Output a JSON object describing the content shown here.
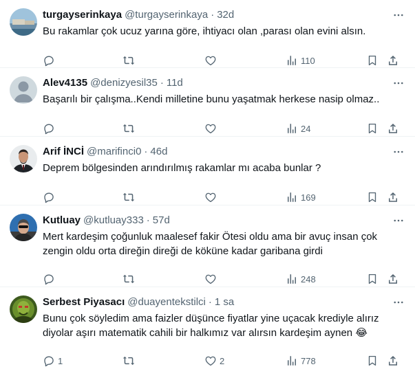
{
  "replies": [
    {
      "name": "turgayserinkaya",
      "handle": "@turgayserinkaya",
      "time": "32d",
      "text": "Bu rakamlar çok ucuz yarına göre, ihtiyacı olan ,parası olan evini alsın.",
      "reply_count": "",
      "repost_count": "",
      "like_count": "",
      "views": "110",
      "avatar": "landscape-photo"
    },
    {
      "name": "Alev4135",
      "handle": "@denizyesil35",
      "time": "11d",
      "text": "Başarılı bir çalışma..Kendi milletine bunu yaşatmak herkese nasip olmaz..",
      "reply_count": "",
      "repost_count": "",
      "like_count": "",
      "views": "24",
      "avatar": "default-person"
    },
    {
      "name": "Arif İNCİ",
      "handle": "@marifinci0",
      "time": "46d",
      "text": "Deprem bölgesinden arındırılmış rakamlar mı acaba bunlar ?",
      "reply_count": "",
      "repost_count": "",
      "like_count": "",
      "views": "169",
      "avatar": "man-in-suit"
    },
    {
      "name": "Kutluay",
      "handle": "@kutluay333",
      "time": "57d",
      "text": "Mert kardeşim çoğunluk maalesef fakir Ötesi oldu ama bir avuç insan çok zengin oldu orta direğin direği de köküne kadar garibana girdi",
      "reply_count": "",
      "repost_count": "",
      "like_count": "",
      "views": "248",
      "avatar": "man-sunglasses"
    },
    {
      "name": "Serbest Piyasacı",
      "handle": "@duayentekstilci",
      "time": "1 sa",
      "text": "Bunu çok söyledim ama faizler düşünce fiyatlar yine uçacak krediyle alırız diyolar aşırı matematik cahili bir halkımız var alırsın kardeşim aynen",
      "emoji": "😂",
      "reply_count": "1",
      "repost_count": "",
      "like_count": "2",
      "views": "778",
      "avatar": "green-figure"
    }
  ],
  "separator": "·",
  "colors": {
    "text": "#0f1419",
    "muted": "#536471",
    "divider": "#eff3f4"
  }
}
